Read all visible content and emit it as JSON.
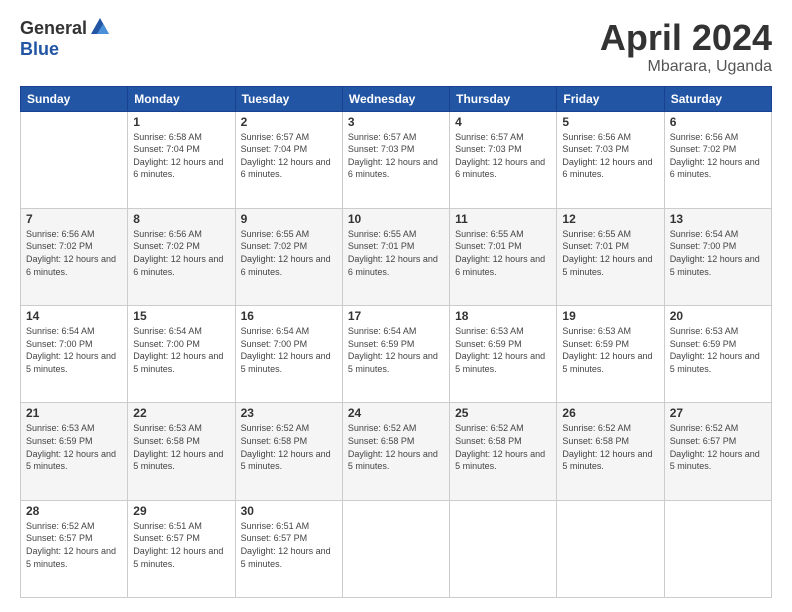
{
  "logo": {
    "general": "General",
    "blue": "Blue"
  },
  "title": {
    "month": "April 2024",
    "location": "Mbarara, Uganda"
  },
  "headers": [
    "Sunday",
    "Monday",
    "Tuesday",
    "Wednesday",
    "Thursday",
    "Friday",
    "Saturday"
  ],
  "weeks": [
    [
      {
        "day": "",
        "sunrise": "",
        "sunset": "",
        "daylight": ""
      },
      {
        "day": "1",
        "sunrise": "Sunrise: 6:58 AM",
        "sunset": "Sunset: 7:04 PM",
        "daylight": "Daylight: 12 hours and 6 minutes."
      },
      {
        "day": "2",
        "sunrise": "Sunrise: 6:57 AM",
        "sunset": "Sunset: 7:04 PM",
        "daylight": "Daylight: 12 hours and 6 minutes."
      },
      {
        "day": "3",
        "sunrise": "Sunrise: 6:57 AM",
        "sunset": "Sunset: 7:03 PM",
        "daylight": "Daylight: 12 hours and 6 minutes."
      },
      {
        "day": "4",
        "sunrise": "Sunrise: 6:57 AM",
        "sunset": "Sunset: 7:03 PM",
        "daylight": "Daylight: 12 hours and 6 minutes."
      },
      {
        "day": "5",
        "sunrise": "Sunrise: 6:56 AM",
        "sunset": "Sunset: 7:03 PM",
        "daylight": "Daylight: 12 hours and 6 minutes."
      },
      {
        "day": "6",
        "sunrise": "Sunrise: 6:56 AM",
        "sunset": "Sunset: 7:02 PM",
        "daylight": "Daylight: 12 hours and 6 minutes."
      }
    ],
    [
      {
        "day": "7",
        "sunrise": "Sunrise: 6:56 AM",
        "sunset": "Sunset: 7:02 PM",
        "daylight": "Daylight: 12 hours and 6 minutes."
      },
      {
        "day": "8",
        "sunrise": "Sunrise: 6:56 AM",
        "sunset": "Sunset: 7:02 PM",
        "daylight": "Daylight: 12 hours and 6 minutes."
      },
      {
        "day": "9",
        "sunrise": "Sunrise: 6:55 AM",
        "sunset": "Sunset: 7:02 PM",
        "daylight": "Daylight: 12 hours and 6 minutes."
      },
      {
        "day": "10",
        "sunrise": "Sunrise: 6:55 AM",
        "sunset": "Sunset: 7:01 PM",
        "daylight": "Daylight: 12 hours and 6 minutes."
      },
      {
        "day": "11",
        "sunrise": "Sunrise: 6:55 AM",
        "sunset": "Sunset: 7:01 PM",
        "daylight": "Daylight: 12 hours and 6 minutes."
      },
      {
        "day": "12",
        "sunrise": "Sunrise: 6:55 AM",
        "sunset": "Sunset: 7:01 PM",
        "daylight": "Daylight: 12 hours and 5 minutes."
      },
      {
        "day": "13",
        "sunrise": "Sunrise: 6:54 AM",
        "sunset": "Sunset: 7:00 PM",
        "daylight": "Daylight: 12 hours and 5 minutes."
      }
    ],
    [
      {
        "day": "14",
        "sunrise": "Sunrise: 6:54 AM",
        "sunset": "Sunset: 7:00 PM",
        "daylight": "Daylight: 12 hours and 5 minutes."
      },
      {
        "day": "15",
        "sunrise": "Sunrise: 6:54 AM",
        "sunset": "Sunset: 7:00 PM",
        "daylight": "Daylight: 12 hours and 5 minutes."
      },
      {
        "day": "16",
        "sunrise": "Sunrise: 6:54 AM",
        "sunset": "Sunset: 7:00 PM",
        "daylight": "Daylight: 12 hours and 5 minutes."
      },
      {
        "day": "17",
        "sunrise": "Sunrise: 6:54 AM",
        "sunset": "Sunset: 6:59 PM",
        "daylight": "Daylight: 12 hours and 5 minutes."
      },
      {
        "day": "18",
        "sunrise": "Sunrise: 6:53 AM",
        "sunset": "Sunset: 6:59 PM",
        "daylight": "Daylight: 12 hours and 5 minutes."
      },
      {
        "day": "19",
        "sunrise": "Sunrise: 6:53 AM",
        "sunset": "Sunset: 6:59 PM",
        "daylight": "Daylight: 12 hours and 5 minutes."
      },
      {
        "day": "20",
        "sunrise": "Sunrise: 6:53 AM",
        "sunset": "Sunset: 6:59 PM",
        "daylight": "Daylight: 12 hours and 5 minutes."
      }
    ],
    [
      {
        "day": "21",
        "sunrise": "Sunrise: 6:53 AM",
        "sunset": "Sunset: 6:59 PM",
        "daylight": "Daylight: 12 hours and 5 minutes."
      },
      {
        "day": "22",
        "sunrise": "Sunrise: 6:53 AM",
        "sunset": "Sunset: 6:58 PM",
        "daylight": "Daylight: 12 hours and 5 minutes."
      },
      {
        "day": "23",
        "sunrise": "Sunrise: 6:52 AM",
        "sunset": "Sunset: 6:58 PM",
        "daylight": "Daylight: 12 hours and 5 minutes."
      },
      {
        "day": "24",
        "sunrise": "Sunrise: 6:52 AM",
        "sunset": "Sunset: 6:58 PM",
        "daylight": "Daylight: 12 hours and 5 minutes."
      },
      {
        "day": "25",
        "sunrise": "Sunrise: 6:52 AM",
        "sunset": "Sunset: 6:58 PM",
        "daylight": "Daylight: 12 hours and 5 minutes."
      },
      {
        "day": "26",
        "sunrise": "Sunrise: 6:52 AM",
        "sunset": "Sunset: 6:58 PM",
        "daylight": "Daylight: 12 hours and 5 minutes."
      },
      {
        "day": "27",
        "sunrise": "Sunrise: 6:52 AM",
        "sunset": "Sunset: 6:57 PM",
        "daylight": "Daylight: 12 hours and 5 minutes."
      }
    ],
    [
      {
        "day": "28",
        "sunrise": "Sunrise: 6:52 AM",
        "sunset": "Sunset: 6:57 PM",
        "daylight": "Daylight: 12 hours and 5 minutes."
      },
      {
        "day": "29",
        "sunrise": "Sunrise: 6:51 AM",
        "sunset": "Sunset: 6:57 PM",
        "daylight": "Daylight: 12 hours and 5 minutes."
      },
      {
        "day": "30",
        "sunrise": "Sunrise: 6:51 AM",
        "sunset": "Sunset: 6:57 PM",
        "daylight": "Daylight: 12 hours and 5 minutes."
      },
      {
        "day": "",
        "sunrise": "",
        "sunset": "",
        "daylight": ""
      },
      {
        "day": "",
        "sunrise": "",
        "sunset": "",
        "daylight": ""
      },
      {
        "day": "",
        "sunrise": "",
        "sunset": "",
        "daylight": ""
      },
      {
        "day": "",
        "sunrise": "",
        "sunset": "",
        "daylight": ""
      }
    ]
  ]
}
